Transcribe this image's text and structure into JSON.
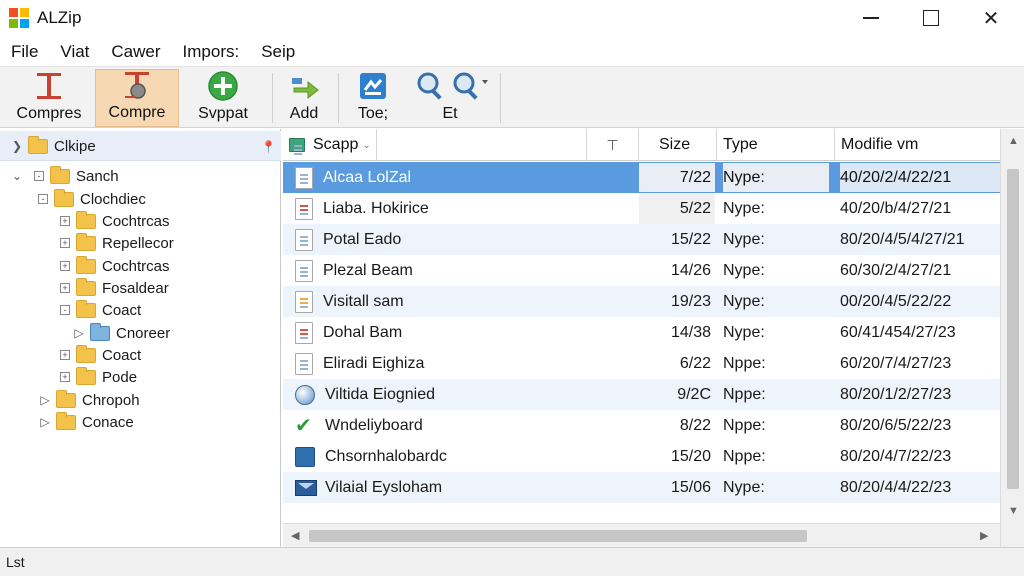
{
  "window": {
    "title": "ALZip"
  },
  "menu": [
    "File",
    "Viat",
    "Cawer",
    "Impors:",
    "Seip"
  ],
  "toolbar": {
    "buttons": [
      {
        "label": "Compres",
        "icon": "compress-icon",
        "active": false
      },
      {
        "label": "Compre",
        "icon": "compress-extract-icon",
        "active": true
      },
      {
        "label": "Svppat",
        "icon": "add-plus-icon",
        "active": false
      },
      {
        "label": "Add",
        "icon": "add-arrow-icon",
        "active": false
      },
      {
        "label": "Toe;",
        "icon": "tool-icon",
        "active": false
      },
      {
        "label": "Et",
        "icon": "magnifier-icon",
        "active": false
      }
    ]
  },
  "tree": {
    "header": "Clkipe",
    "items": [
      {
        "label": "Sanch",
        "level": 0
      },
      {
        "label": "Clochdiec",
        "level": 1
      },
      {
        "label": "Cochtrcas",
        "level": 2
      },
      {
        "label": "Repellecor",
        "level": 2
      },
      {
        "label": "Cochtrcas",
        "level": 2
      },
      {
        "label": "Fosaldear",
        "level": 2
      },
      {
        "label": "Coact",
        "level": 2
      },
      {
        "label": "Cnoreer",
        "level": 3
      },
      {
        "label": "Coact",
        "level": 2
      },
      {
        "label": "Pode",
        "level": 2
      },
      {
        "label": "Chropoh",
        "level": 1
      },
      {
        "label": "Conace",
        "level": 1
      }
    ]
  },
  "list": {
    "columns": {
      "name": "Scapp",
      "size": "Size",
      "type": "Type",
      "modified": "Modifie vm"
    },
    "rows": [
      {
        "name": "Alcaa LolZal",
        "size": "7/22",
        "type": "Nype:",
        "modified": "40/20/2/4/22/21",
        "icon": "document-icon"
      },
      {
        "name": "Liaba. Hokirice",
        "size": "5/22",
        "type": "Nype:",
        "modified": "40/20/b/4/27/21",
        "icon": "pdf-document-icon"
      },
      {
        "name": "Potal Eado",
        "size": "15/22",
        "type": "Nype:",
        "modified": "80/20/4/5/4/27/21",
        "icon": "document-icon"
      },
      {
        "name": "Plezal Beam",
        "size": "14/26",
        "type": "Nype:",
        "modified": "60/30/2/4/27/21",
        "icon": "document-icon"
      },
      {
        "name": "Visitall sam",
        "size": "19/23",
        "type": "Nype:",
        "modified": "00/20/4/5/22/22",
        "icon": "text-document-icon"
      },
      {
        "name": "Dohal Bam",
        "size": "14/38",
        "type": "Nype:",
        "modified": "60/41/454/27/23",
        "icon": "spreadsheet-icon"
      },
      {
        "name": "Eliradi Eighiza",
        "size": "6/22",
        "type": "Nppe:",
        "modified": "60/20/7/4/27/23",
        "icon": "document-icon"
      },
      {
        "name": "Viltida Eiognied",
        "size": "9/2C",
        "type": "Nppe:",
        "modified": "80/20/1/2/27/23",
        "icon": "disc-icon"
      },
      {
        "name": "Wndeliyboard",
        "size": "8/22",
        "type": "Nppe:",
        "modified": "80/20/6/5/22/23",
        "icon": "checkmark-icon"
      },
      {
        "name": "Chsornhalobardc",
        "size": "15/20",
        "type": "Nppe:",
        "modified": "80/20/4/7/22/23",
        "icon": "image-icon"
      },
      {
        "name": "Vilaial Eysloham",
        "size": "15/06",
        "type": "Nype:",
        "modified": "80/20/4/4/22/23",
        "icon": "mail-icon"
      }
    ]
  },
  "status": {
    "text": "Lst"
  }
}
